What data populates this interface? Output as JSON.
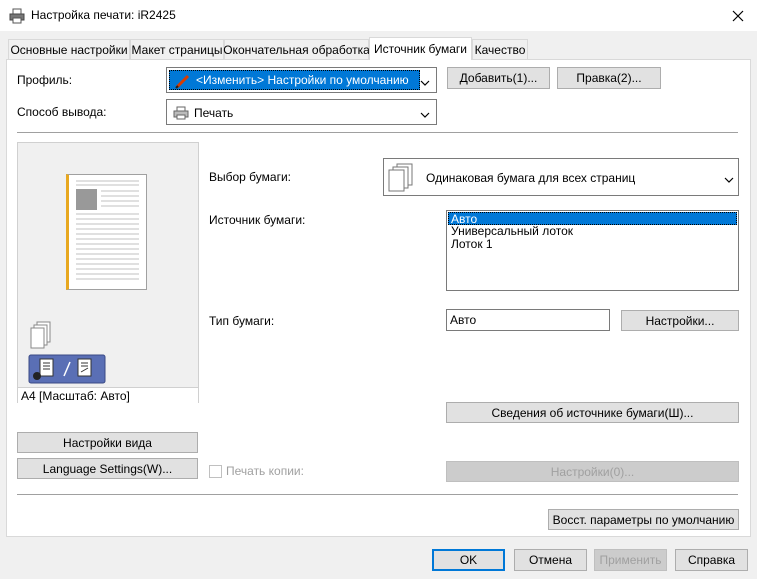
{
  "window": {
    "title": "Настройка печати: iR2425"
  },
  "tabs": [
    {
      "label": "Основные настройки"
    },
    {
      "label": "Макет страницы"
    },
    {
      "label": "Окончательная обработка"
    },
    {
      "label": "Источник бумаги"
    },
    {
      "label": "Качество"
    }
  ],
  "profile": {
    "label": "Профиль:",
    "value": "<Изменить> Настройки по умолчанию",
    "add_button": "Добавить(1)...",
    "edit_button": "Правка(2)..."
  },
  "output": {
    "label": "Способ вывода:",
    "value": "Печать"
  },
  "preview": {
    "caption": "A4 [Масштаб: Авто]",
    "view_settings_button": "Настройки вида",
    "language_button": "Language Settings(W)..."
  },
  "paper_selection": {
    "label": "Выбор бумаги:",
    "value": "Одинаковая бумага для всех страниц"
  },
  "paper_source": {
    "label": "Источник бумаги:",
    "options": [
      "Авто",
      "Универсальный лоток",
      "Лоток 1"
    ],
    "selected": "Авто"
  },
  "paper_type": {
    "label": "Тип бумаги:",
    "value": "Авто",
    "settings_button": "Настройки..."
  },
  "source_info_button": "Сведения об источнике бумаги(Ш)...",
  "print_copies": {
    "label": "Печать копии:",
    "checked": false,
    "settings_button": "Настройки(0)..."
  },
  "restore_defaults_button": "Восст. параметры по умолчанию",
  "footer": {
    "ok": "OK",
    "cancel": "Отмена",
    "apply": "Применить",
    "help": "Справка"
  },
  "colors": {
    "accent": "#0078d7",
    "dialog_bg": "#f0f0f0",
    "button_bg": "#e1e1e1"
  }
}
